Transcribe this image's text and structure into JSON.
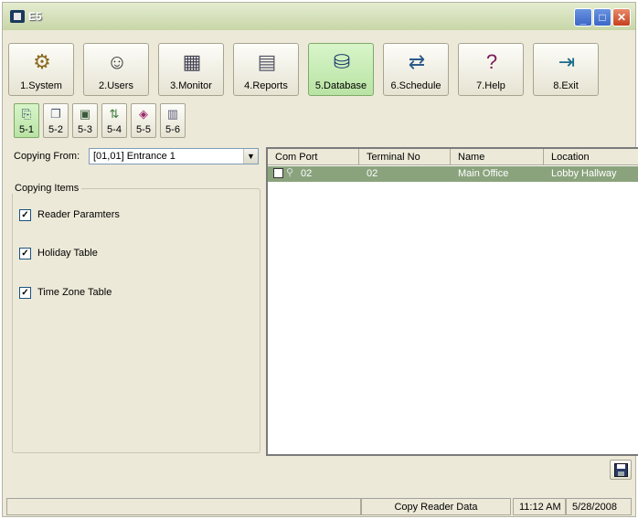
{
  "window": {
    "title": "E5"
  },
  "toolbar": {
    "buttons": [
      {
        "label": "1.System",
        "icon": "system-icon"
      },
      {
        "label": "2.Users",
        "icon": "users-icon"
      },
      {
        "label": "3.Monitor",
        "icon": "monitor-icon"
      },
      {
        "label": "4.Reports",
        "icon": "reports-icon"
      },
      {
        "label": "5.Database",
        "icon": "database-icon",
        "active": true
      },
      {
        "label": "6.Schedule",
        "icon": "schedule-icon"
      },
      {
        "label": "7.Help",
        "icon": "help-book-icon"
      },
      {
        "label": "8.Exit",
        "icon": "exit-door-icon"
      }
    ]
  },
  "subtoolbar": {
    "buttons": [
      {
        "label": "5-1",
        "active": true
      },
      {
        "label": "5-2"
      },
      {
        "label": "5-3"
      },
      {
        "label": "5-4"
      },
      {
        "label": "5-5"
      },
      {
        "label": "5-6"
      }
    ]
  },
  "copy_from": {
    "label": "Copying From:",
    "value": "[01,01] Entrance 1"
  },
  "copying_items": {
    "legend": "Copying Items",
    "items": [
      {
        "label": "Reader Paramters",
        "checked": true
      },
      {
        "label": "Holiday Table",
        "checked": true
      },
      {
        "label": "Time Zone Table",
        "checked": true
      }
    ]
  },
  "table": {
    "columns": [
      "Com Port",
      "Terminal No",
      "Name",
      "Location"
    ],
    "rows": [
      {
        "com_port": "02",
        "terminal_no": "02",
        "name": "Main Office",
        "location": "Lobby Hallway"
      }
    ]
  },
  "status": {
    "message": "Copy Reader Data",
    "time": "11:12 AM",
    "date": "5/28/2008"
  },
  "colors": {
    "active_button": "#b9e3a4",
    "selected_row": "#8aa37d",
    "window_bg": "#ece9d8"
  }
}
